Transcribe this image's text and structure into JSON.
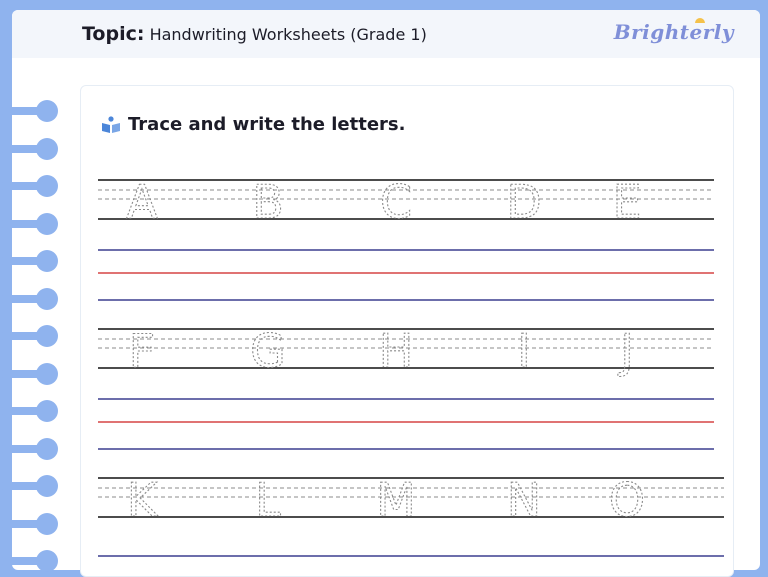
{
  "header": {
    "topic_label": "Topic:",
    "topic_value": "Handwriting Worksheets (Grade 1)",
    "logo": "Brighterly"
  },
  "worksheet": {
    "instruction": "Trace and write the letters.",
    "rows": [
      [
        "A",
        "B",
        "C",
        "D",
        "E"
      ],
      [
        "F",
        "G",
        "H",
        "I",
        "J"
      ],
      [
        "K",
        "L",
        "M",
        "N",
        "O"
      ]
    ]
  },
  "colors": {
    "background": "#8fb3ee",
    "guide_blue": "#3b3f8f",
    "guide_red": "#d64545",
    "icon_blue": "#4c86d9"
  },
  "icons": {
    "instruction_icon": "book-icon",
    "binding": "spiral-rings"
  }
}
